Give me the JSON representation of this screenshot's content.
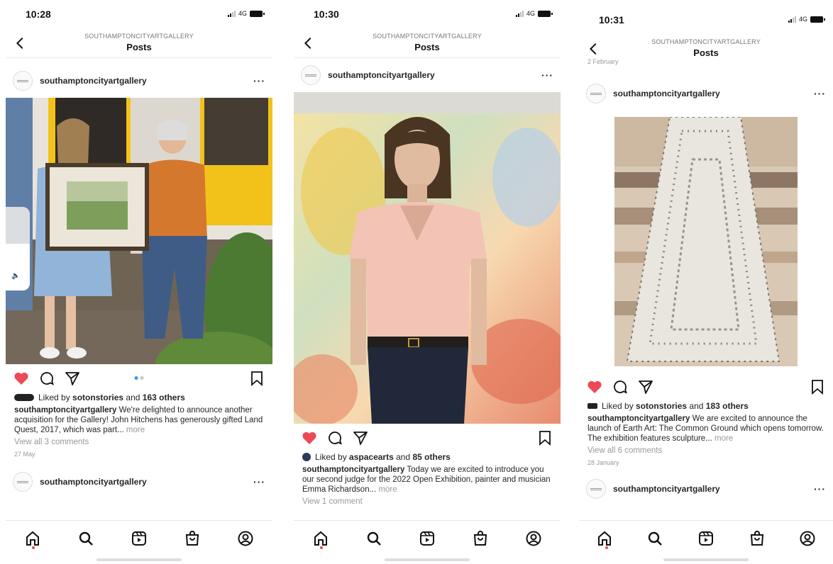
{
  "screens": [
    {
      "time": "10:28",
      "network": "4G",
      "header": {
        "account": "SOUTHAMPTONCITYARTGALLERY",
        "title": "Posts"
      },
      "post": {
        "username": "southamptoncityartgallery",
        "likes_prefix": "Liked by",
        "liked_by": "sotonstories",
        "likes_suffix": "and",
        "others": "163 others",
        "caption_user": "southamptoncityartgallery",
        "caption": "We're delighted to announce another acquisition for the Gallery! John Hitchens has generously gifted Land Quest, 2017, which was part...",
        "more": "more",
        "comments": "View all 3 comments",
        "date": "27 May"
      },
      "next_username": "southamptoncityartgallery"
    },
    {
      "time": "10:30",
      "network": "4G",
      "header": {
        "account": "SOUTHAMPTONCITYARTGALLERY",
        "title": "Posts"
      },
      "post": {
        "username": "southamptoncityartgallery",
        "likes_prefix": "Liked by",
        "liked_by": "aspacearts",
        "likes_suffix": "and",
        "others": "85 others",
        "caption_user": "southamptoncityartgallery",
        "caption": "Today we are excited to introduce you our second judge for the 2022 Open Exhibition, painter and musician Emma Richardson...",
        "more": "more",
        "comments": "View 1 comment"
      }
    },
    {
      "time": "10:31",
      "network": "4G",
      "header": {
        "account": "SOUTHAMPTONCITYARTGALLERY",
        "title": "Posts"
      },
      "prev_date": "2 February",
      "post": {
        "username": "southamptoncityartgallery",
        "likes_prefix": "Liked by",
        "liked_by": "sotonstories",
        "likes_suffix": "and",
        "others": "183 others",
        "caption_user": "southamptoncityartgallery",
        "caption": "We are excited to announce the launch of Earth Art: The Common Ground which opens tomorrow. The exhibition features sculpture...",
        "more": "more",
        "comments": "View all 6 comments",
        "date": "28 January"
      },
      "next_username": "southamptoncityartgallery"
    }
  ],
  "icons": {
    "back": "chevron-left-icon",
    "more": "more-horizontal-icon",
    "like": "heart-icon",
    "comment": "comment-icon",
    "share": "send-icon",
    "save": "bookmark-icon",
    "home": "home-icon",
    "search": "search-icon",
    "reels": "reels-icon",
    "shop": "shop-icon",
    "profile": "profile-icon",
    "volume": "volume-icon"
  },
  "colors": {
    "like": "#ed4956",
    "carousel_active": "#3897f0",
    "text": "#262626",
    "muted": "#8e8e8e"
  }
}
